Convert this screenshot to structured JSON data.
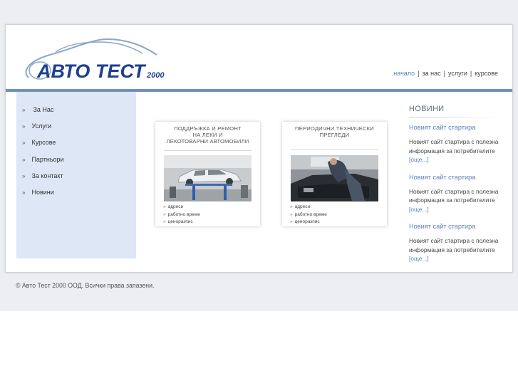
{
  "logo": {
    "text": "АВТО ТЕСТ",
    "year": "2000",
    "color": "#1f3f8f"
  },
  "topnav": [
    {
      "label": "начало",
      "active": true
    },
    {
      "label": "за нас",
      "active": false
    },
    {
      "label": "услуги",
      "active": false
    },
    {
      "label": "курсове",
      "active": false
    }
  ],
  "sidebar": {
    "bullet": "»",
    "items": [
      "За Нас",
      "Услуги",
      "Курсове",
      "Партньори",
      "За контакт",
      "Новини"
    ]
  },
  "cards": [
    {
      "title_lines": [
        "ПОДДРЪЖКА И РЕМОНТ",
        "НА ЛЕКИ И",
        "ЛЕКОТОВАРНИ АВТОМОБИЛИ"
      ],
      "links": [
        "адреси",
        "работно време",
        "ценоразпис"
      ]
    },
    {
      "title_lines": [
        "ПЕРИОДИЧНИ ТЕХНИЧЕСКИ",
        "ПРЕГЛЕДИ"
      ],
      "links": [
        "адреси",
        "работно време",
        "ценоразпис"
      ]
    }
  ],
  "news": {
    "heading": "НОВИНИ",
    "items": [
      {
        "title": "Новият сайт стартира",
        "body": "Новият сайт стартира с полезна информация за потребителите",
        "more": "[още...]"
      },
      {
        "title": "Новият сайт стартира",
        "body": "Новият сайт стартира с полезна информация за потребителите",
        "more": "[още...]"
      },
      {
        "title": "Новият сайт стартира",
        "body": "Новият сайт стартира с полезна информация за потребителите",
        "more": "[още...]"
      }
    ]
  },
  "footer": {
    "text": "© Авто Тест 2000 ООД. Всички права запазени."
  },
  "colors": {
    "accent": "#6f92bd",
    "link": "#5c82b6",
    "sidebar_bg": "#dde7f6",
    "page_bg": "#eceef1"
  }
}
